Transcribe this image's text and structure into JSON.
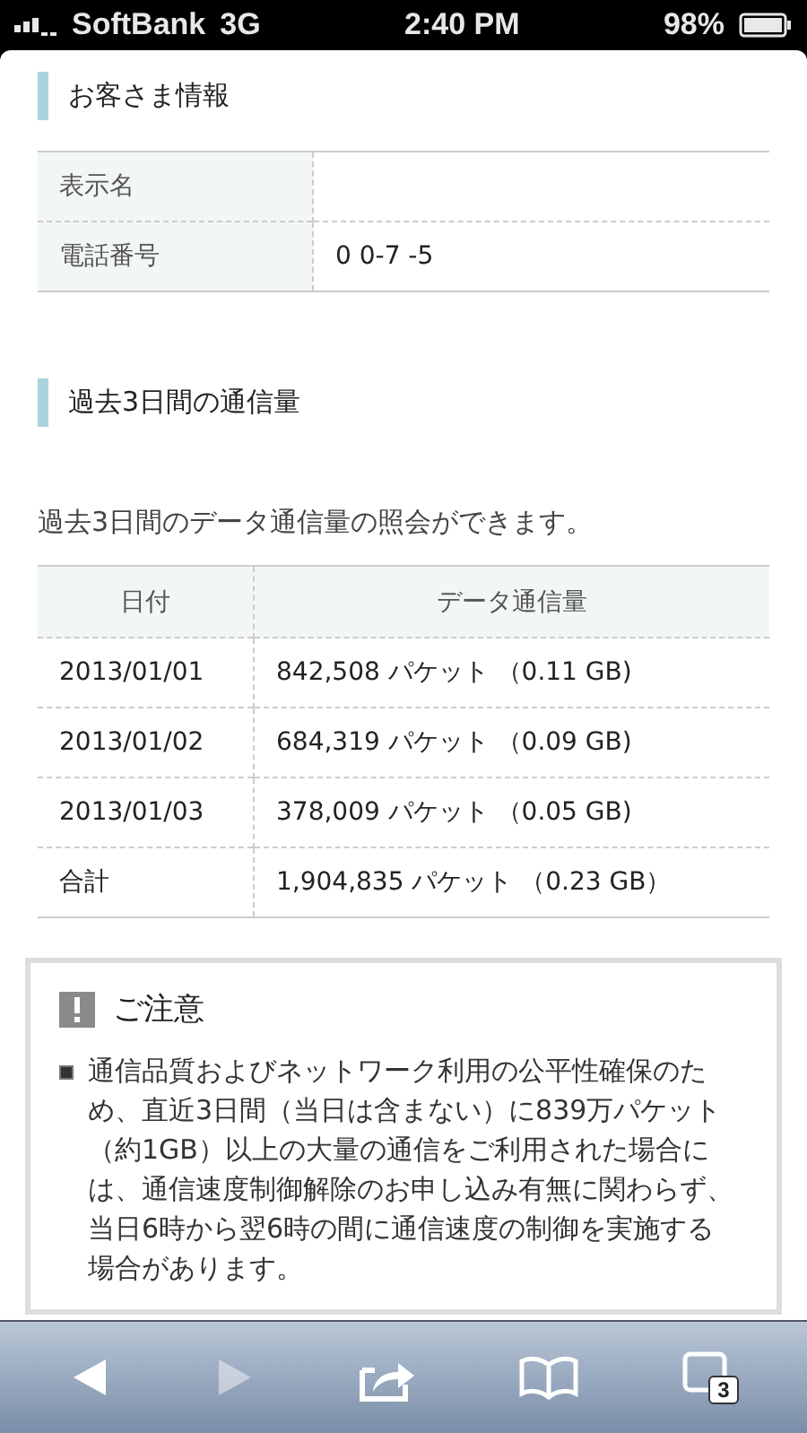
{
  "status_bar": {
    "carrier": "SoftBank",
    "network": "3G",
    "time": "2:40 PM",
    "battery": "98%"
  },
  "customer_section": {
    "title": "お客さま情報",
    "rows": [
      {
        "label": "表示名",
        "value": ""
      },
      {
        "label": "電話番号",
        "value": "0 0-7  -5"
      }
    ]
  },
  "usage_section": {
    "title": "過去3日間の通信量",
    "description": "過去3日間のデータ通信量の照会ができます。",
    "columns": [
      "日付",
      "データ通信量"
    ],
    "rows": [
      {
        "date": "2013/01/01",
        "amount": "842,508 パケット （0.11 GB)"
      },
      {
        "date": "2013/01/02",
        "amount": "684,319 パケット （0.09 GB)"
      },
      {
        "date": "2013/01/03",
        "amount": "378,009 パケット （0.05 GB)"
      },
      {
        "date": "合計",
        "amount": "1,904,835 パケット （0.23 GB）"
      }
    ]
  },
  "notice": {
    "title": "ご注意",
    "items": [
      "通信品質およびネットワーク利用の公平性確保のため、直近3日間（当日は含まない）に839万パケット（約1GB）以上の大量の通信をご利用された場合には、通信速度制御解除のお申し込み有無に関わらず、当日6時から翌6時の間に通信速度の制御を実施する場合があります。"
    ]
  },
  "toolbar": {
    "back_disabled": false,
    "forward_disabled": true,
    "tab_count": "3"
  }
}
